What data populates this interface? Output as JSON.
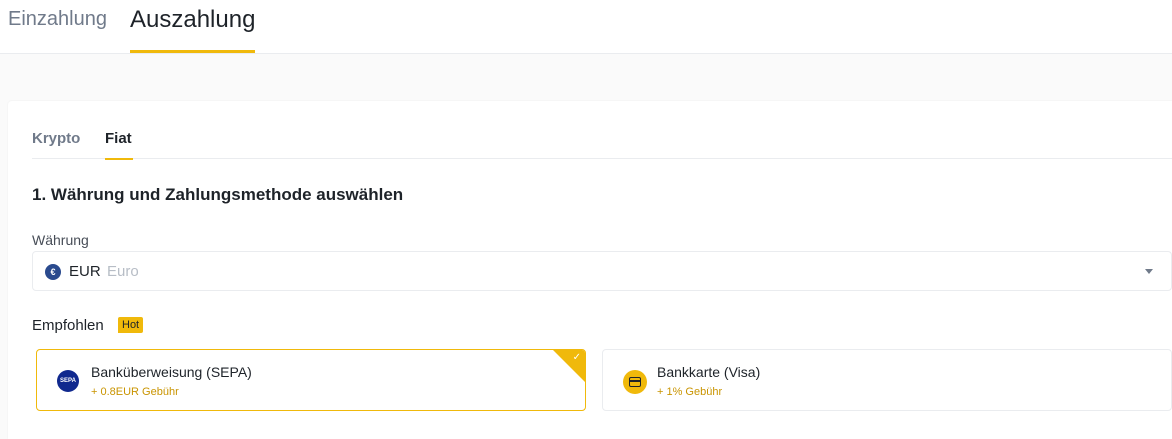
{
  "top_tabs": [
    "Einzahlung",
    "Auszahlung"
  ],
  "sub_tabs": [
    "Krypto",
    "Fiat"
  ],
  "section_title": "1. Währung und Zahlungsmethode auswählen",
  "currency": {
    "label": "Währung",
    "icon": "€",
    "code": "EUR",
    "name": "Euro"
  },
  "recommended": {
    "label": "Empfohlen",
    "badge": "Hot"
  },
  "methods": [
    {
      "name": "Banküberweisung (SEPA)",
      "fee": "+ 0.8EUR Gebühr",
      "icon": "SEPA",
      "selected": true
    },
    {
      "name": "Bankkarte (Visa)",
      "fee": "+ 1% Gebühr",
      "icon": "card-icon",
      "selected": false
    }
  ],
  "colors": {
    "accent": "#f0b90b",
    "fee_text": "#c99400",
    "muted": "#707a8a"
  }
}
